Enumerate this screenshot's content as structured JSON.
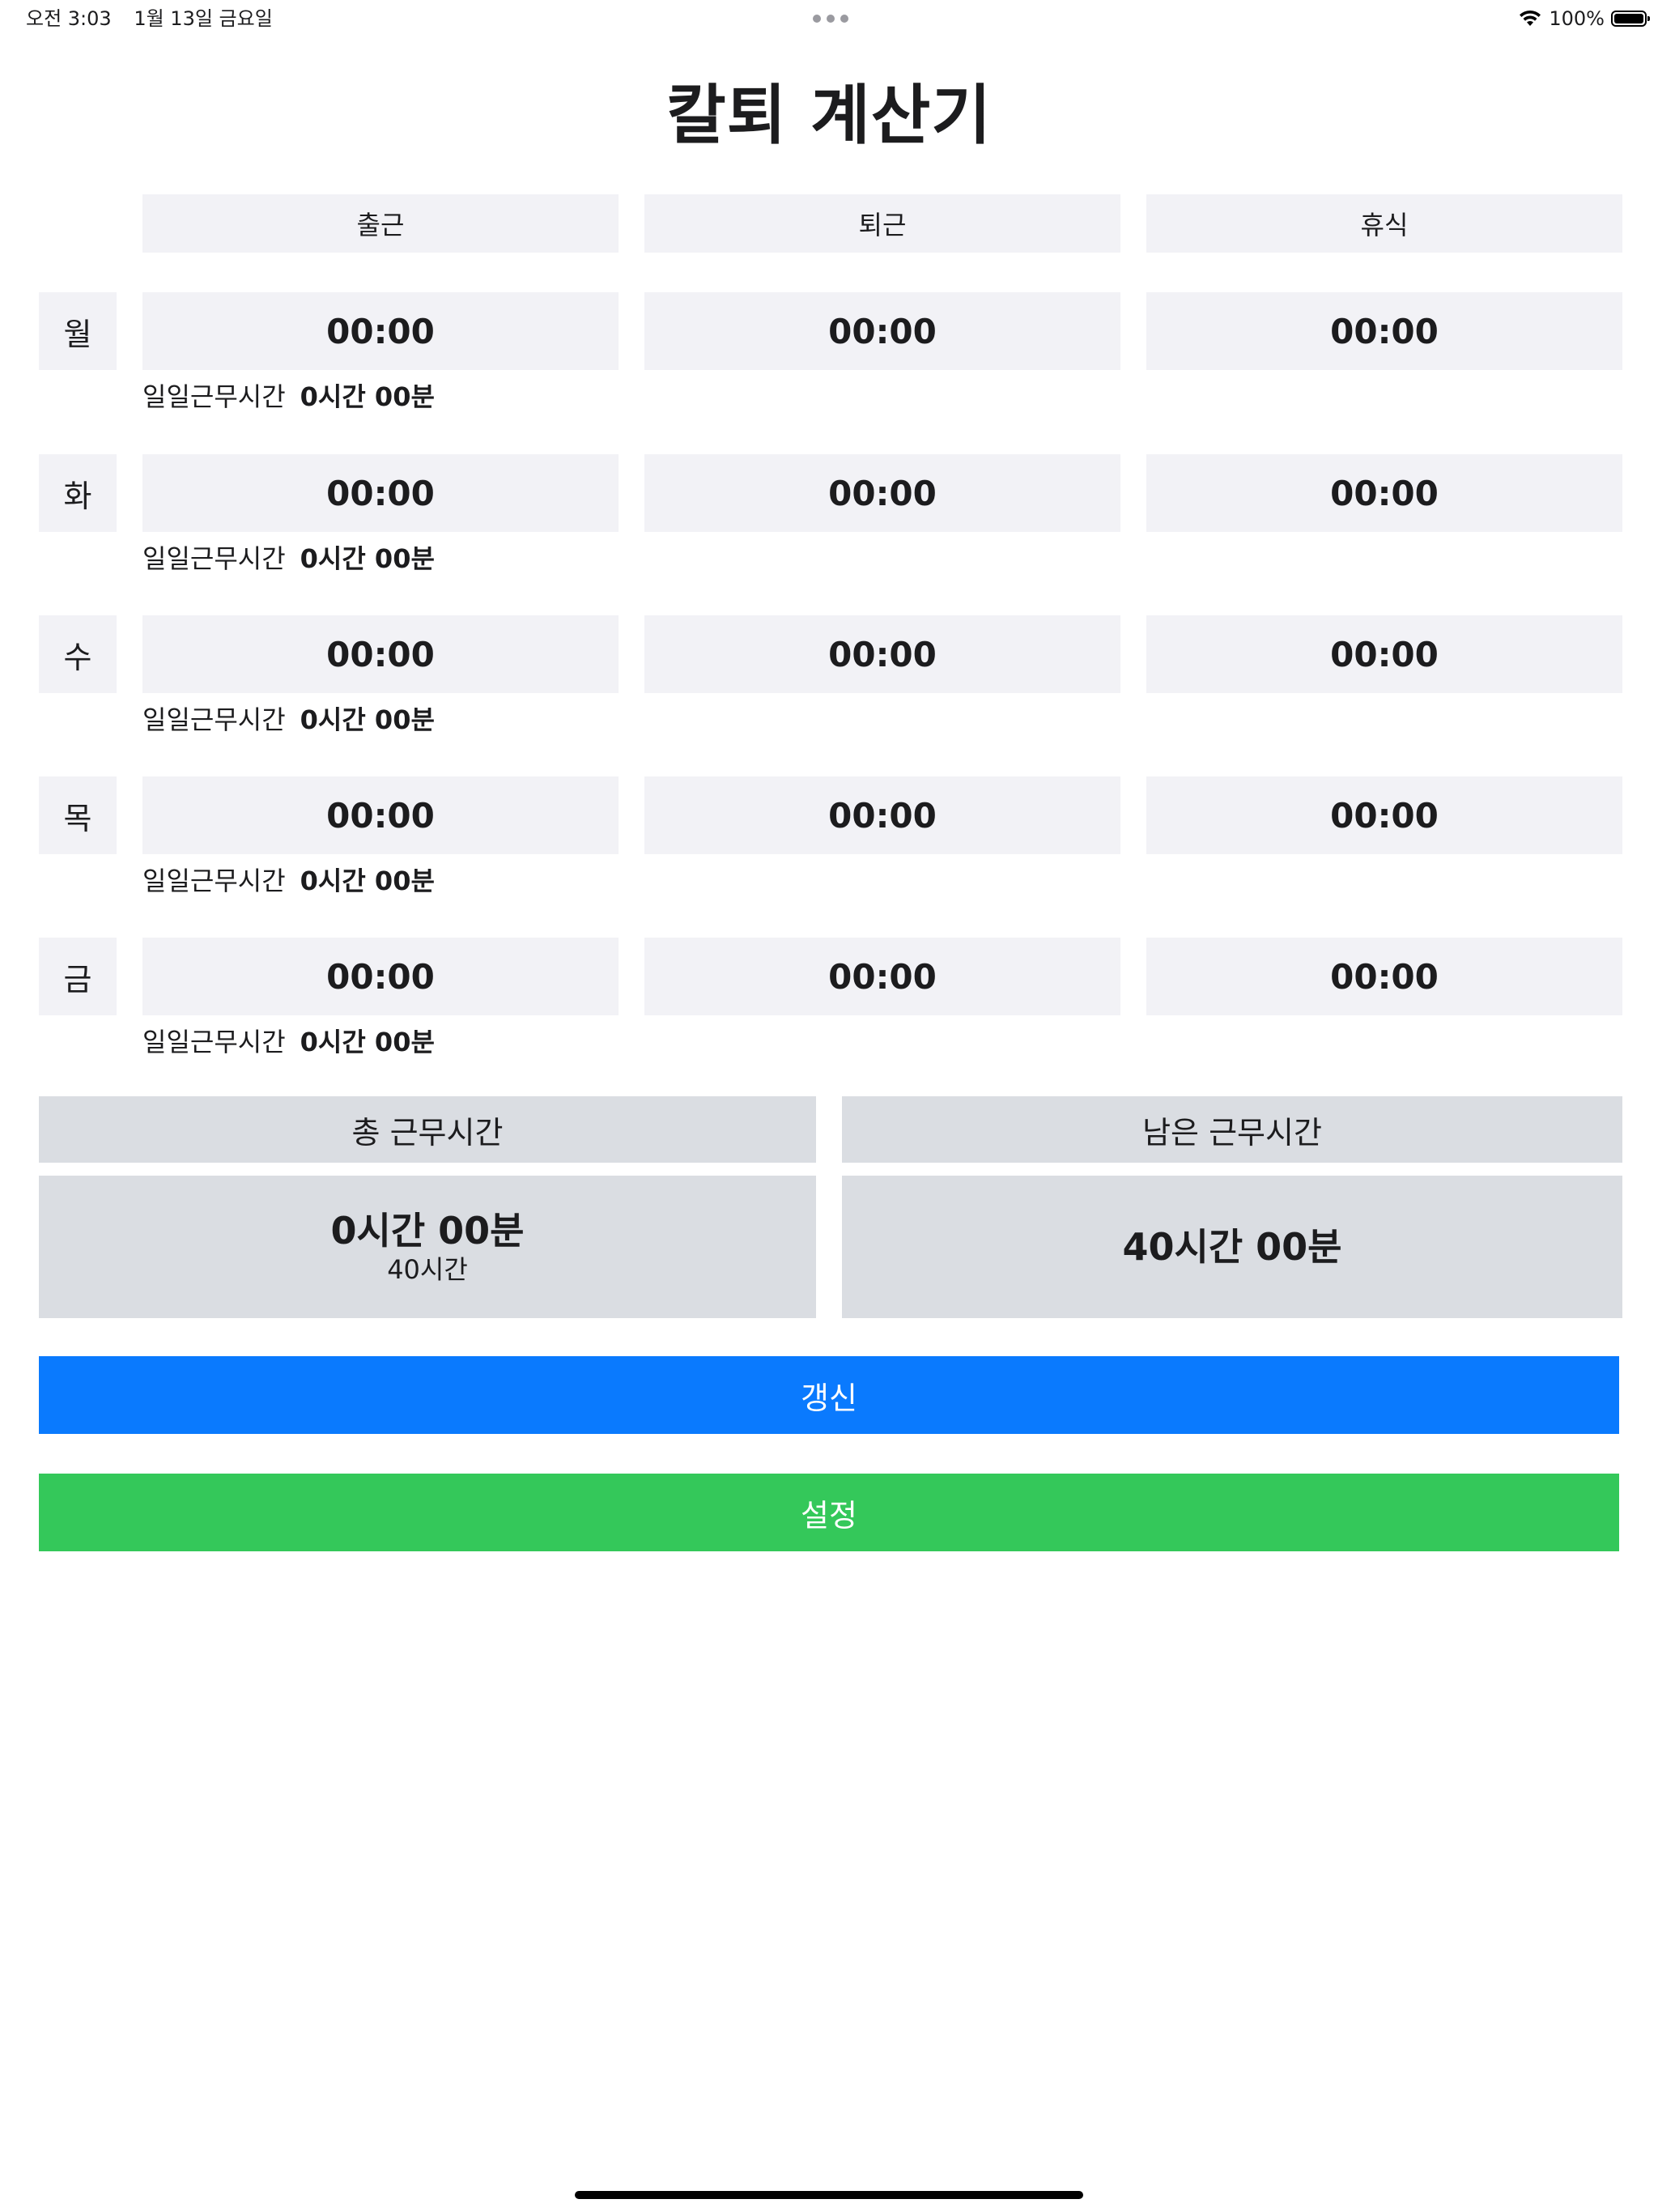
{
  "status_bar": {
    "time": "오전 3:03",
    "date": "1월 13일 금요일",
    "battery_text": "100%",
    "battery_level": 1.0
  },
  "title": "칼퇴 계산기",
  "columns": [
    "출근",
    "퇴근",
    "휴식"
  ],
  "days": [
    {
      "label": "월",
      "start": "00:00",
      "end": "00:00",
      "rest": "00:00",
      "daily_label": "일일근무시간",
      "daily_value": "0시간 00분"
    },
    {
      "label": "화",
      "start": "00:00",
      "end": "00:00",
      "rest": "00:00",
      "daily_label": "일일근무시간",
      "daily_value": "0시간 00분"
    },
    {
      "label": "수",
      "start": "00:00",
      "end": "00:00",
      "rest": "00:00",
      "daily_label": "일일근무시간",
      "daily_value": "0시간 00분"
    },
    {
      "label": "목",
      "start": "00:00",
      "end": "00:00",
      "rest": "00:00",
      "daily_label": "일일근무시간",
      "daily_value": "0시간 00분"
    },
    {
      "label": "금",
      "start": "00:00",
      "end": "00:00",
      "rest": "00:00",
      "daily_label": "일일근무시간",
      "daily_value": "0시간 00분"
    }
  ],
  "summary": {
    "total_label": "총 근무시간",
    "total_value": "0시간 00분",
    "total_target": "40시간",
    "remaining_label": "남은 근무시간",
    "remaining_value": "40시간 00분"
  },
  "buttons": {
    "refresh": "갱신",
    "settings": "설정"
  },
  "colors": {
    "refresh_button": "#0a7afe",
    "settings_button": "#34c85a",
    "cell_background": "#f2f2f6",
    "summary_background": "#dadde2"
  }
}
